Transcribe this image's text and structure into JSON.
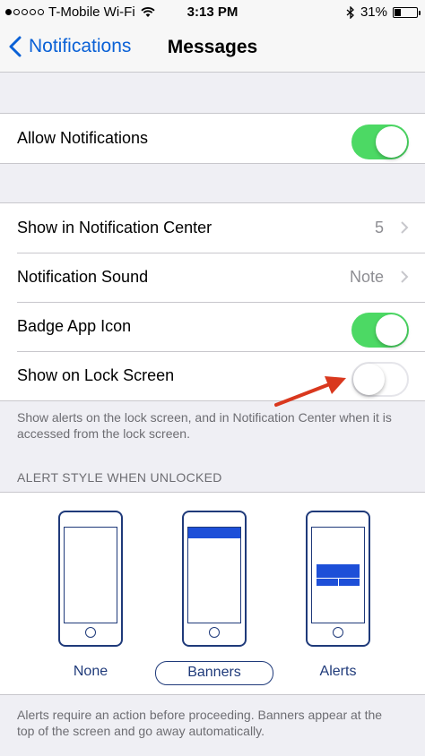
{
  "status_bar": {
    "carrier": "T-Mobile Wi-Fi",
    "time": "3:13 PM",
    "battery": "31%",
    "battery_level": 0.31
  },
  "nav": {
    "back_label": "Notifications",
    "title": "Messages"
  },
  "allow_group": {
    "label": "Allow Notifications",
    "toggle_on": true
  },
  "settings": {
    "rows": [
      {
        "label": "Show in Notification Center",
        "value": "5"
      },
      {
        "label": "Notification Sound",
        "value": "Note"
      },
      {
        "label": "Badge App Icon",
        "toggle_on": true
      },
      {
        "label": "Show on Lock Screen",
        "toggle_on": false
      }
    ],
    "footnote": "Show alerts on the lock screen, and in Notification Center when it is accessed from the lock screen."
  },
  "alert_style": {
    "header": "ALERT STYLE WHEN UNLOCKED",
    "options": [
      {
        "label": "None"
      },
      {
        "label": "Banners"
      },
      {
        "label": "Alerts"
      }
    ],
    "selected": "Banners",
    "footnote": "Alerts require an action before proceeding. Banners appear at the top of the screen and go away automatically."
  },
  "colors": {
    "accent": "#0a61d6",
    "toggle_on": "#4cd964",
    "arrow": "#d9381e",
    "phone_outline": "#1f3a7a"
  }
}
